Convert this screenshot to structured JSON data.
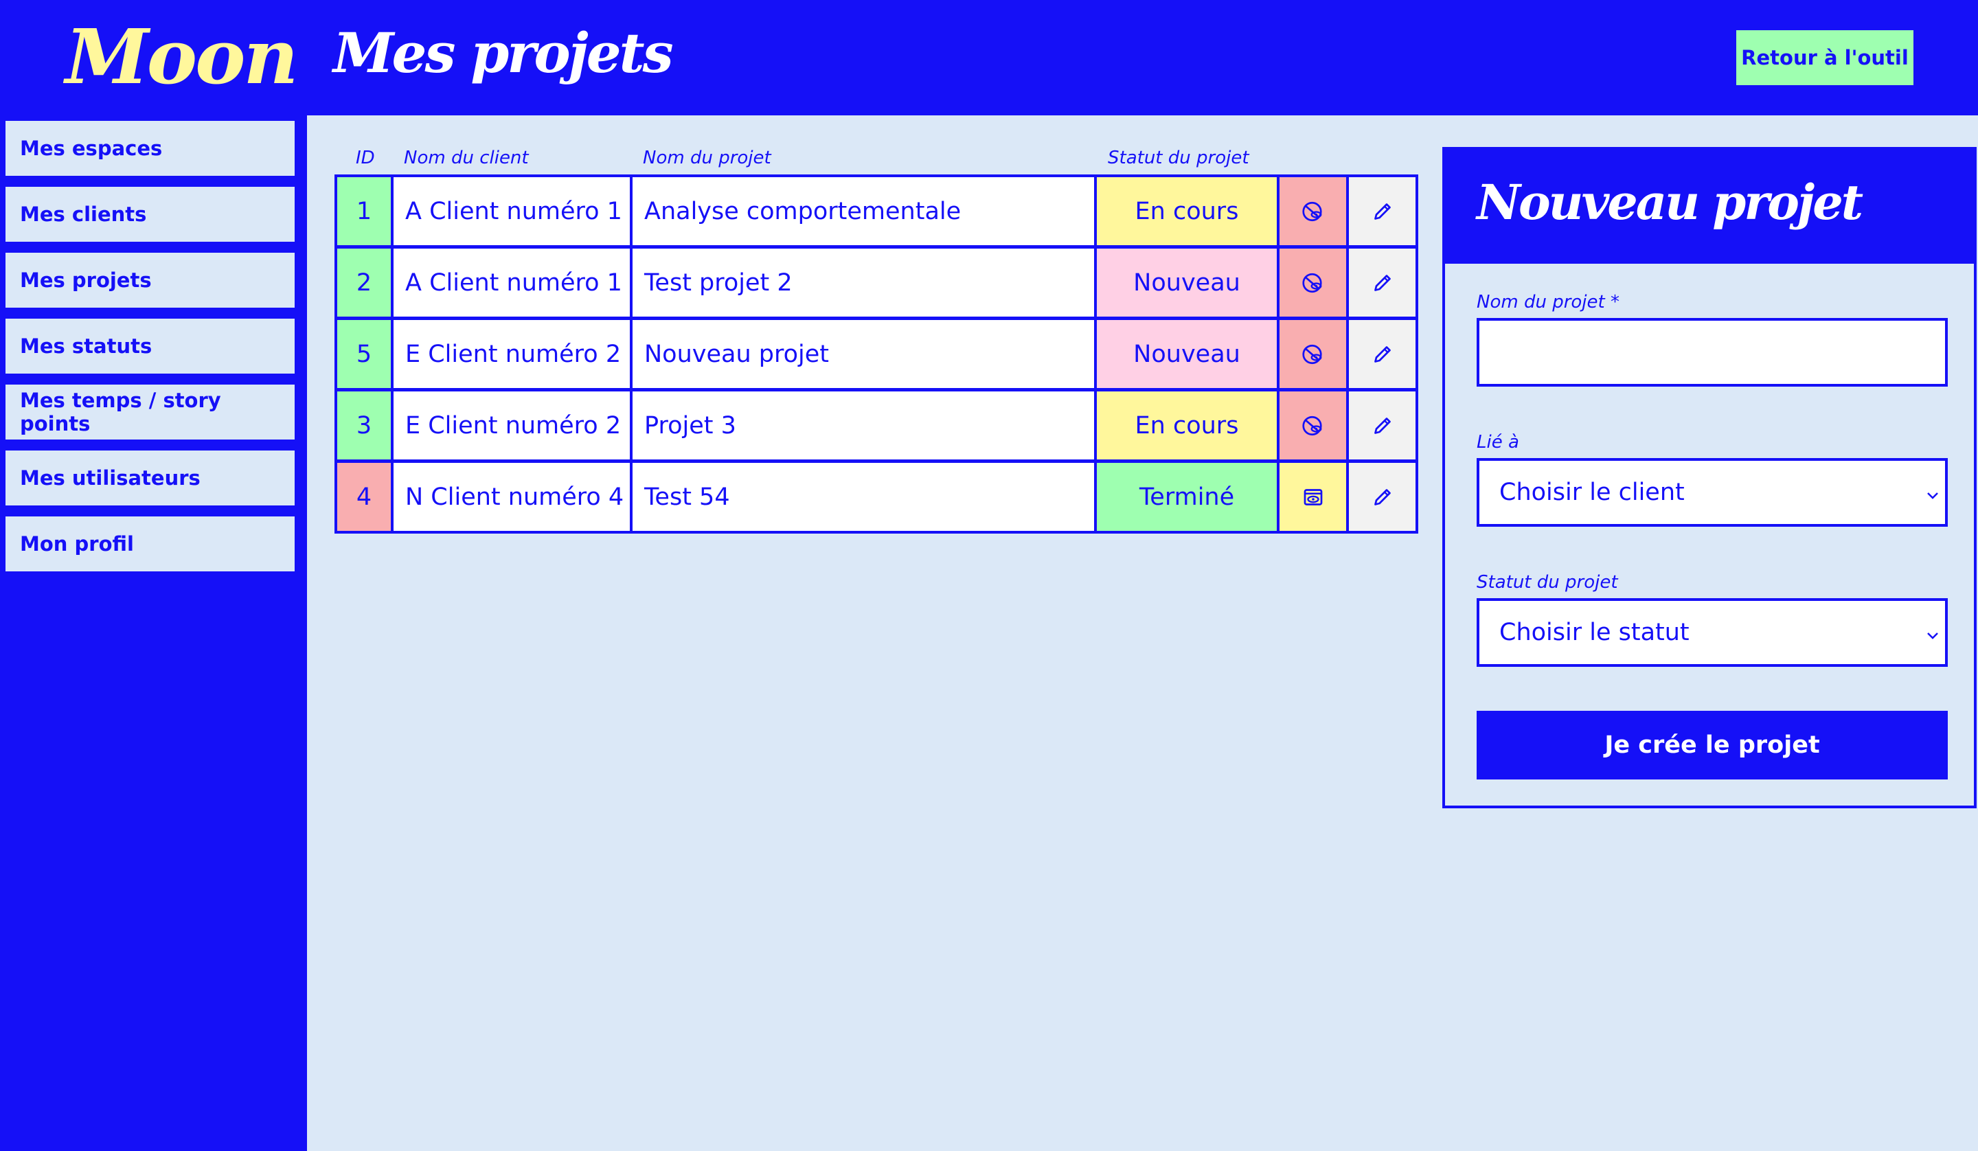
{
  "app": {
    "logo": "Moon",
    "page_title": "Mes projets",
    "back_button": "Retour à l'outil"
  },
  "sidebar": {
    "items": [
      {
        "label": "Mes espaces"
      },
      {
        "label": "Mes clients"
      },
      {
        "label": "Mes projets"
      },
      {
        "label": "Mes statuts"
      },
      {
        "label": "Mes temps / story points"
      },
      {
        "label": "Mes utilisateurs"
      },
      {
        "label": "Mon profil"
      }
    ]
  },
  "table": {
    "headers": {
      "id": "ID",
      "client": "Nom du client",
      "project": "Nom du projet",
      "status": "Statut du projet"
    },
    "rows": [
      {
        "id": "1",
        "client": "A Client numéro 1",
        "project": "Analyse comportementale",
        "status": "En cours",
        "visibility_icon": "eye-hidden-icon"
      },
      {
        "id": "2",
        "client": "A Client numéro 1",
        "project": "Test projet 2",
        "status": "Nouveau",
        "visibility_icon": "eye-hidden-icon"
      },
      {
        "id": "5",
        "client": "E Client numéro 2",
        "project": "Nouveau projet",
        "status": "Nouveau",
        "visibility_icon": "eye-hidden-icon"
      },
      {
        "id": "3",
        "client": "E Client numéro 2",
        "project": "Projet 3",
        "status": "En cours",
        "visibility_icon": "eye-hidden-icon"
      },
      {
        "id": "4",
        "client": "N Client numéro 4",
        "project": "Test 54",
        "status": "Terminé",
        "visibility_icon": "eye-visible-icon"
      }
    ]
  },
  "form": {
    "title": "Nouveau projet",
    "name_label": "Nom du projet *",
    "name_value": "",
    "client_label": "Lié à",
    "client_selected": "Choisir le client",
    "status_label": "Statut du projet",
    "status_selected": "Choisir le statut",
    "submit_label": "Je crée le projet"
  },
  "colors": {
    "primary": "#1510f7",
    "background": "#dbe8f7",
    "accent_green": "#9effb0",
    "logo_yellow": "#fff79c",
    "status_en_cours": "#fff79c",
    "status_nouveau": "#ffd0e5",
    "status_termine": "#9effb0",
    "id_active": "#9effb0",
    "id_done": "#f9aeb0",
    "action_hidden": "#f9aeb0",
    "action_visible": "#fff79c",
    "edit_cell": "#f2f2f2"
  }
}
